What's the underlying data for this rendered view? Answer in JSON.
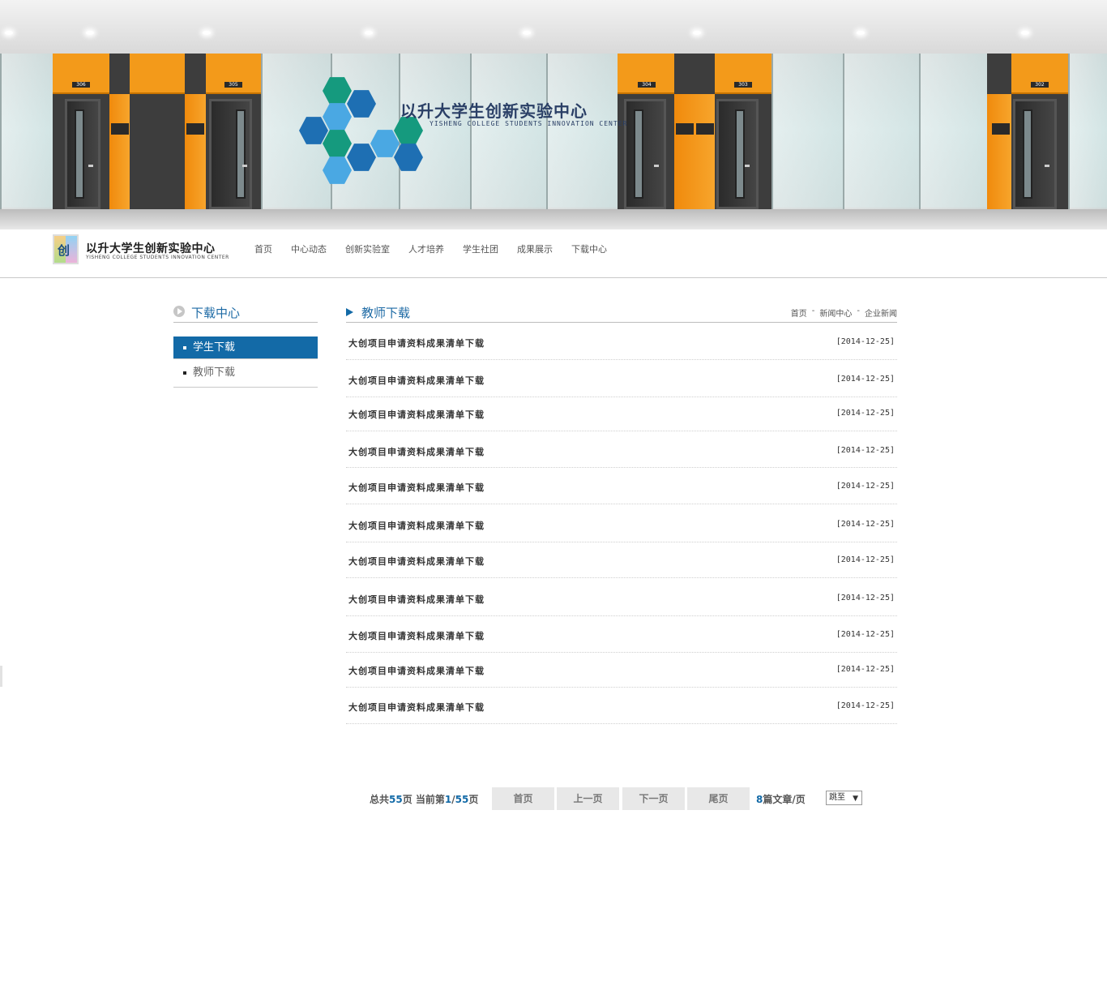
{
  "banner": {
    "title": "以升大学生创新实验中心",
    "subtitle": "YISHENG COLLEGE STUDENTS INNOVATION CENTER",
    "room_numbers": [
      "306",
      "305",
      "304",
      "303",
      "302"
    ]
  },
  "header": {
    "logo_glyph": "创",
    "logo_title": "以升大学生创新实验中心",
    "logo_subtitle": "YISHENG COLLEGE STUDENTS INNOVATION CENTER",
    "nav": [
      "首页",
      "中心动态",
      "创新实验室",
      "人才培养",
      "学生社团",
      "成果展示",
      "下载中心"
    ]
  },
  "sidebar": {
    "title": "下载中心",
    "items": [
      {
        "label": "学生下载",
        "active": true
      },
      {
        "label": "教师下载",
        "active": false
      }
    ]
  },
  "main": {
    "title": "教师下载",
    "breadcrumb": [
      "首页",
      "新闻中心",
      "企业新闻"
    ],
    "breadcrumb_sep": "-",
    "list": [
      {
        "title": "大创项目申请资料成果清单下载",
        "date": "[2014-12-25]"
      },
      {
        "title": "大创项目申请资料成果清单下载",
        "date": "[2014-12-25]"
      },
      {
        "title": "大创项目申请资料成果清单下载",
        "date": "[2014-12-25]"
      },
      {
        "title": "大创项目申请资料成果清单下载",
        "date": "[2014-12-25]"
      },
      {
        "title": "大创项目申请资料成果清单下载",
        "date": "[2014-12-25]"
      },
      {
        "title": "大创项目申请资料成果清单下载",
        "date": "[2014-12-25]"
      },
      {
        "title": "大创项目申请资料成果清单下载",
        "date": "[2014-12-25]"
      },
      {
        "title": "大创项目申请资料成果清单下载",
        "date": "[2014-12-25]"
      },
      {
        "title": "大创项目申请资料成果清单下载",
        "date": "[2014-12-25]"
      },
      {
        "title": "大创项目申请资料成果清单下载",
        "date": "[2014-12-25]"
      },
      {
        "title": "大创项目申请资料成果清单下载",
        "date": "[2014-12-25]"
      }
    ]
  },
  "pager": {
    "total_prefix": "总共",
    "total_pages": "55",
    "total_suffix": "页 当前第",
    "current_page": "1",
    "slash": "/",
    "current_total": "55",
    "current_suffix": "页",
    "first": "首页",
    "prev": "上一页",
    "next": "下一页",
    "last": "尾页",
    "per_page": "8",
    "per_suffix": "篇文章/页",
    "jump_label": "跳至",
    "jump_caret": "▼"
  },
  "colors": {
    "accent": "#136aa7",
    "banner_orange": "#f39a1a"
  }
}
